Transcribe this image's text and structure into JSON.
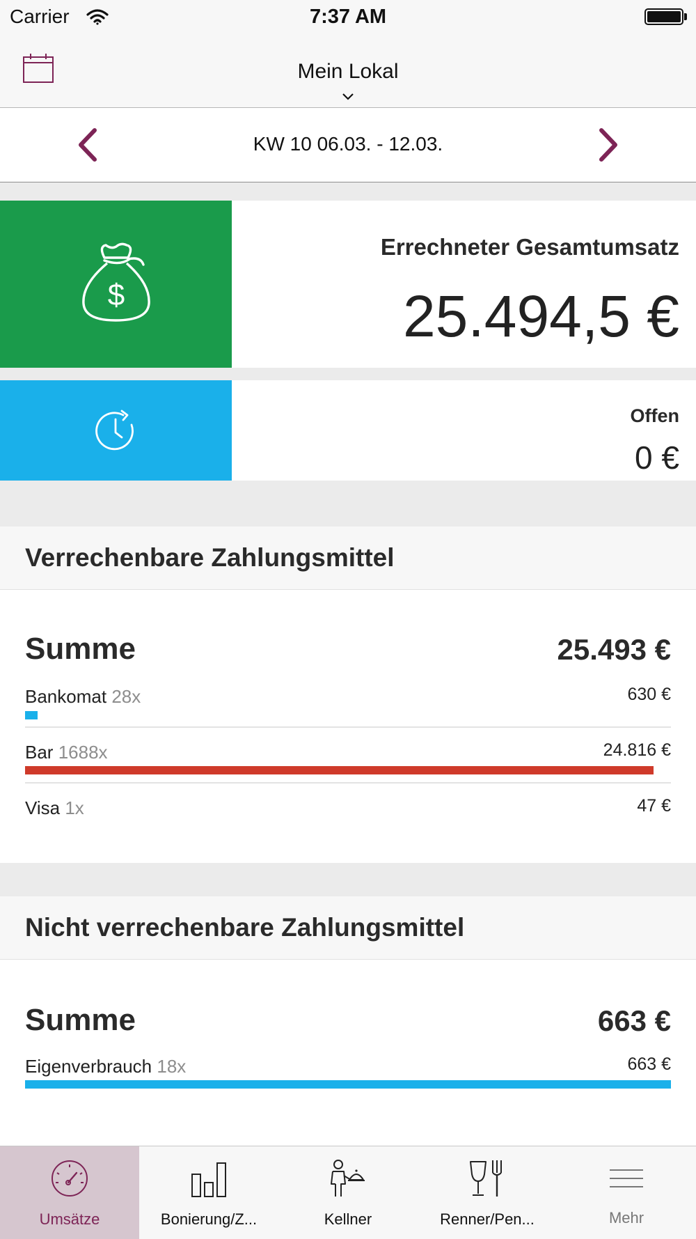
{
  "status_bar": {
    "carrier": "Carrier",
    "time": "7:37 AM"
  },
  "nav": {
    "title": "Mein Lokal"
  },
  "week_selector": {
    "label": "KW 10 06.03. - 12.03."
  },
  "kpis": {
    "total_title": "Errechneter Gesamtumsatz",
    "total_value": "25.494,5 €",
    "open_title": "Offen",
    "open_value": "0 €"
  },
  "billable": {
    "header": "Verrechenbare Zahlungsmittel",
    "sum_label": "Summe",
    "sum_value": "25.493 €",
    "rows": [
      {
        "label": "Bankomat",
        "count": "28x",
        "value": "630 €",
        "share": 0.018,
        "bar_color": "#1ab0ea"
      },
      {
        "label": "Bar",
        "count": "1688x",
        "value": "24.816 €",
        "share": 0.973,
        "bar_color": "#cf3a2a"
      },
      {
        "label": "Visa",
        "count": "1x",
        "value": "47 €",
        "share": 0.0018,
        "bar_color": "#1ab0ea"
      }
    ]
  },
  "non_billable": {
    "header": "Nicht verrechenbare Zahlungsmittel",
    "sum_label": "Summe",
    "sum_value": "663 €",
    "rows": [
      {
        "label": "Eigenverbrauch",
        "count": "18x",
        "value": "663 €",
        "share": 1.0,
        "bar_color": "#1ab0ea"
      }
    ]
  },
  "tabs": [
    {
      "label": "Umsätze",
      "icon": "speedometer-icon",
      "active": true
    },
    {
      "label": "Bonierung/Z...",
      "icon": "bar-chart-icon",
      "active": false
    },
    {
      "label": "Kellner",
      "icon": "waiter-icon",
      "active": false
    },
    {
      "label": "Renner/Pen...",
      "icon": "glass-cutlery-icon",
      "active": false
    },
    {
      "label": "Mehr",
      "icon": "menu-icon",
      "active": false
    }
  ],
  "colors": {
    "accent": "#7d2456",
    "green_tile": "#1a9b4b",
    "blue_tile": "#1ab0ea",
    "bar_red": "#cf3a2a",
    "bar_blue": "#1ab0ea",
    "active_tab_bg": "#d6c6cf"
  }
}
